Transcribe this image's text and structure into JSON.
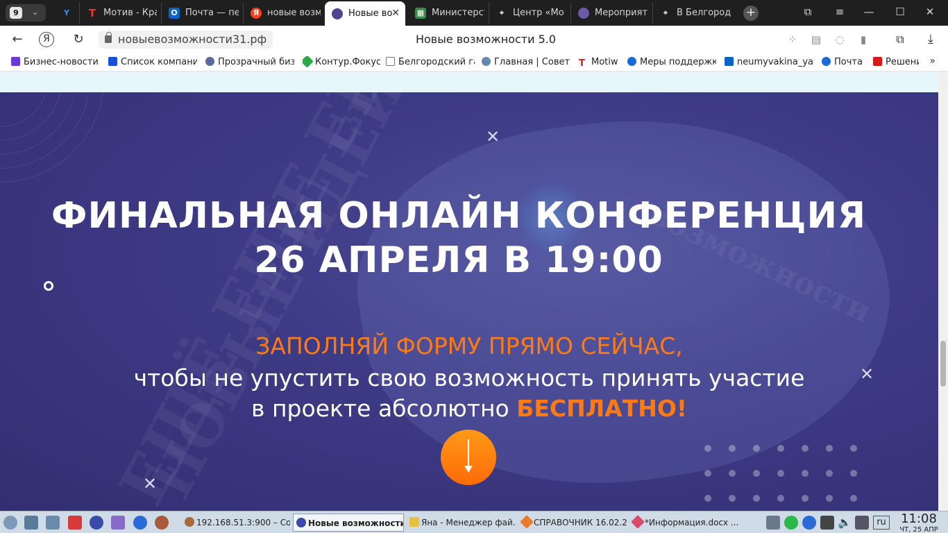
{
  "browser": {
    "tab_count": "9",
    "tabs": [
      {
        "label": "",
        "icon": "yandex-y-icon"
      },
      {
        "label": "Мотив - Кра",
        "icon": "motiv-icon"
      },
      {
        "label": "Почта — пе",
        "icon": "outlook-icon"
      },
      {
        "label": "новые возм",
        "icon": "yandex-icon"
      },
      {
        "label": "Новые во",
        "icon": "site-favicon",
        "active": true
      },
      {
        "label": "Министерст",
        "icon": "ministry-icon"
      },
      {
        "label": "Центр «Мо",
        "icon": "location-pin-icon"
      },
      {
        "label": "Мероприят",
        "icon": "event-icon"
      },
      {
        "label": "В Белгород",
        "icon": "location-pin-icon"
      }
    ],
    "url": "новыевозможности31.рф",
    "page_title": "Новые возможности 5.0",
    "bookmarks": [
      {
        "label": "Бизнес-новости с",
        "color": "#6a3ad8"
      },
      {
        "label": "Список компани",
        "color": "#1a4fd8"
      },
      {
        "label": "Прозрачный биз",
        "color": "#5a6a9a"
      },
      {
        "label": "Контур.Фокус",
        "color": "#2aa84a"
      },
      {
        "label": "Белгородский га",
        "color": "#777777"
      },
      {
        "label": "Главная | Совет м",
        "color": "#6688aa"
      },
      {
        "label": "Motiw",
        "color": "#e01818"
      },
      {
        "label": "Меры поддержк",
        "color": "#1a6ad8"
      },
      {
        "label": "neumyvakina_yas",
        "color": "#0a64c8"
      },
      {
        "label": "Почта",
        "color": "#1a6ad8"
      },
      {
        "label": "Решени",
        "color": "#d81a1a"
      }
    ]
  },
  "hero": {
    "title_line1": "ФИНАЛЬНАЯ ОНЛАЙН КОНФЕРЕНЦИЯ",
    "title_line2": "26 АПРЕЛЯ В 19:00",
    "cta_line1": "ЗАПОЛНЯЙ ФОРМУ ПРЯМО СЕЙЧАС,",
    "cta_line2": "чтобы не упустить свою возможность принять участие",
    "cta_line3_prefix": "в проекте абсолютно ",
    "cta_line3_emphasis": "БЕСПЛАТНО!",
    "accent_color": "#ff7a12",
    "background_color": "#3e3b86"
  },
  "taskbar": {
    "tasks": [
      {
        "label": "192.168.51.3:900 – Со..."
      },
      {
        "label": "Новые возможности ...",
        "active": true
      },
      {
        "label": "Яна - Менеджер фай..."
      },
      {
        "label": "СПРАВОЧНИК 16.02.2..."
      },
      {
        "label": "*Информация.docx ..."
      }
    ],
    "language": "ru",
    "time": "11:08",
    "date": "ЧТ, 25 АПР"
  }
}
